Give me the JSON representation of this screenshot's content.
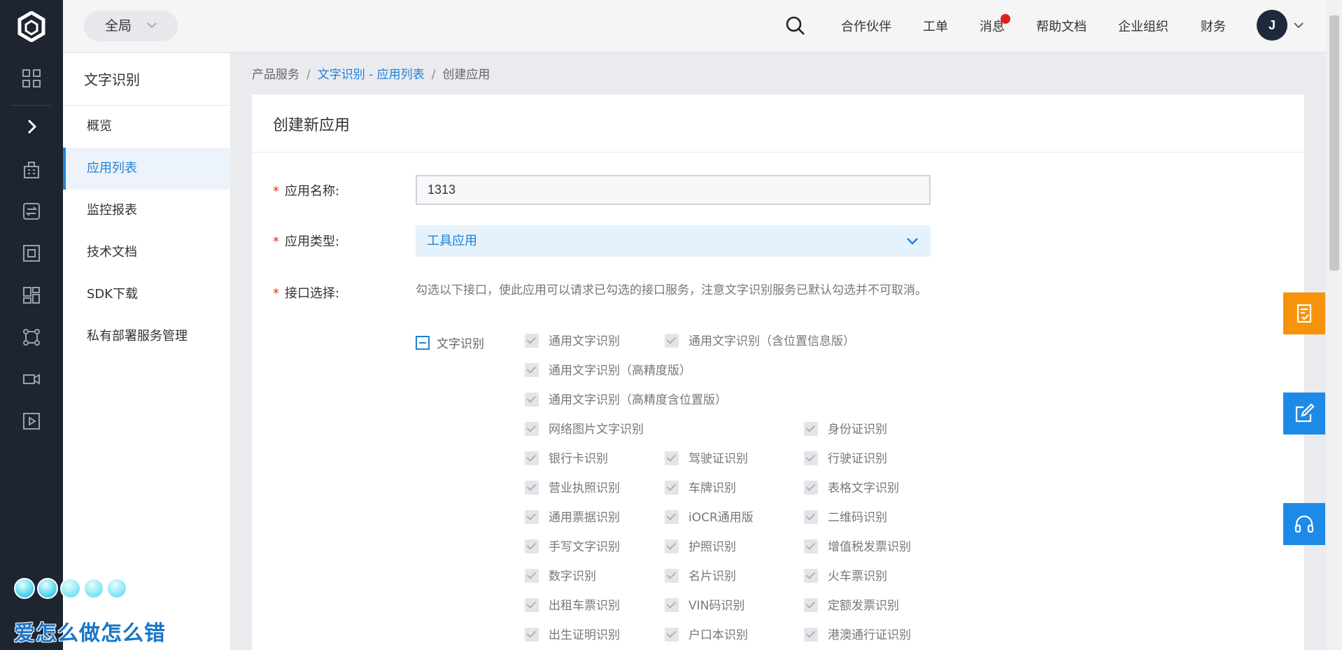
{
  "topbar": {
    "scope": "全局",
    "nav": [
      "合作伙伴",
      "工单",
      "消息",
      "帮助文档",
      "企业组织",
      "财务"
    ],
    "avatar": "J",
    "unread_dot_color": "#e02020"
  },
  "rail": {
    "icons": [
      "grid-icon",
      "chevron-right-icon",
      "building-icon",
      "transfer-icon",
      "chip-icon",
      "dashboard-icon",
      "network-icon",
      "camera-icon",
      "play-icon"
    ]
  },
  "sidebar": {
    "title": "文字识别",
    "items": [
      {
        "label": "概览",
        "active": false
      },
      {
        "label": "应用列表",
        "active": true
      },
      {
        "label": "监控报表",
        "active": false
      },
      {
        "label": "技术文档",
        "active": false
      },
      {
        "label": "SDK下载",
        "active": false
      },
      {
        "label": "私有部署服务管理",
        "active": false
      }
    ]
  },
  "breadcrumb": {
    "root": "产品服务",
    "link": "文字识别 - 应用列表",
    "current": "创建应用",
    "sep": "/"
  },
  "form": {
    "heading": "创建新应用",
    "required_mark": "*",
    "name_label": "应用名称:",
    "name_value": "1313",
    "type_label": "应用类型:",
    "type_value": "工具应用",
    "api_label": "接口选择:",
    "api_hint": "勾选以下接口，使此应用可以请求已勾选的接口服务，注意文字识别服务已默认勾选并不可取消。",
    "group_label": "文字识别",
    "checkboxes": [
      "通用文字识别",
      "通用文字识别（含位置信息版）",
      "通用文字识别（高精度版）",
      "通用文字识别（高精度含位置版）",
      "网络图片文字识别",
      "身份证识别",
      "银行卡识别",
      "驾驶证识别",
      "行驶证识别",
      "营业执照识别",
      "车牌识别",
      "表格文字识别",
      "通用票据识别",
      "iOCR通用版",
      "二维码识别",
      "手写文字识别",
      "护照识别",
      "增值税发票识别",
      "数字识别",
      "名片识别",
      "火车票识别",
      "出租车票识别",
      "VIN码识别",
      "定额发票识别",
      "出生证明识别",
      "户口本识别",
      "港澳通行证识别"
    ]
  },
  "floating": {
    "buttons": [
      {
        "icon": "checklist-icon",
        "color": "#f7930a"
      },
      {
        "icon": "edit-icon",
        "color": "#1e8ae8"
      },
      {
        "icon": "headset-icon",
        "color": "#1e8ae8"
      }
    ]
  },
  "watermark": {
    "text": "爱怎么做怎么错"
  },
  "colors": {
    "accent": "#2081d6",
    "rail": "#1e2430",
    "required": "#e0301e"
  }
}
